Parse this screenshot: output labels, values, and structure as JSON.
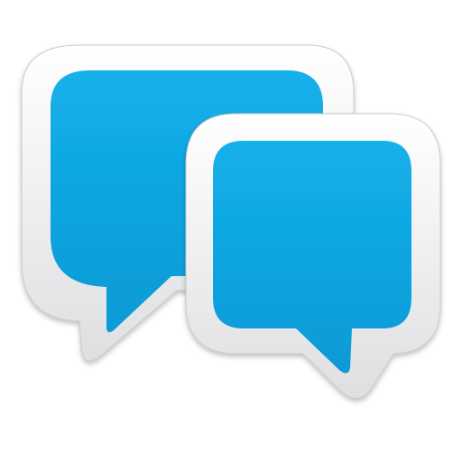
{
  "icon": {
    "name": "chat-bubbles-icon",
    "bubble_fill_top": "#14b0ea",
    "bubble_fill_bottom": "#0a9ad6",
    "frame_top": "#ffffff",
    "frame_bottom": "#dedfe1",
    "frame_edge": "#c9cacc"
  }
}
